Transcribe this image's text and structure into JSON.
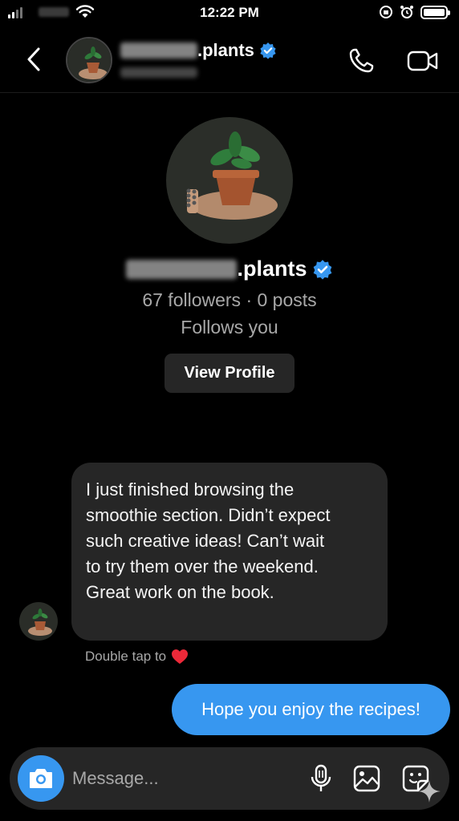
{
  "status_bar": {
    "time": "12:22 PM"
  },
  "header": {
    "username_suffix": ".plants",
    "verified": true
  },
  "profile": {
    "username_suffix": ".plants",
    "stats": "67 followers · 0 posts",
    "follows_you": "Follows you",
    "view_profile_label": "View Profile"
  },
  "messages": {
    "incoming": [
      "I just finished browsing the",
      "smoothie section. Didn’t expect",
      "such creative ideas! Can’t wait",
      "to try them over the weekend.",
      "Great work on the book."
    ],
    "double_tap_hint": "Double tap to",
    "outgoing": "Hope you enjoy the recipes!"
  },
  "composer": {
    "placeholder": "Message..."
  },
  "colors": {
    "accent": "#3797f0",
    "bubble": "#262626",
    "secondary_text": "#a8a8a8",
    "heart": "#ed2939"
  }
}
